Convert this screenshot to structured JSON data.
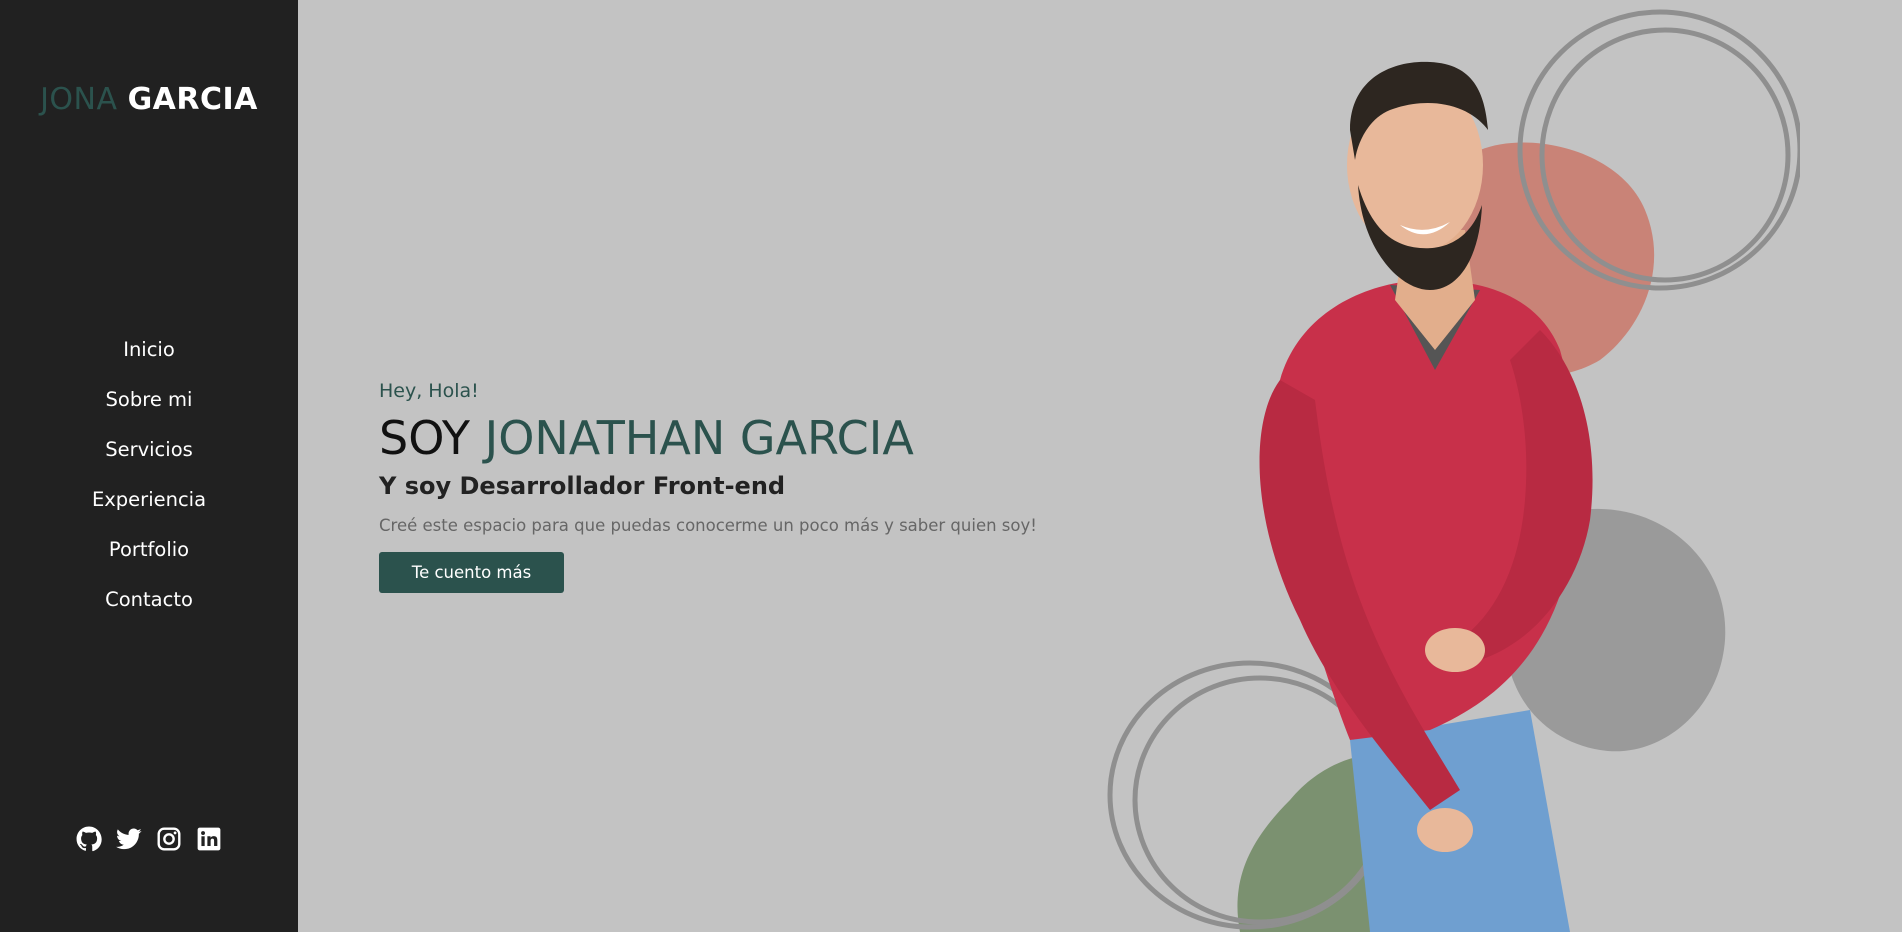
{
  "sidebar": {
    "logo_first": "JONA",
    "logo_last": "GARCIA",
    "nav": [
      "Inicio",
      "Sobre mi",
      "Servicios",
      "Experiencia",
      "Portfolio",
      "Contacto"
    ],
    "social_icons": [
      "github-icon",
      "twitter-icon",
      "instagram-icon",
      "linkedin-icon"
    ]
  },
  "hero": {
    "greeting": "Hey, Hola!",
    "headline_prefix": "SOY",
    "headline_name": "JONATHAN GARCIA",
    "subtitle": "Y soy Desarrollador Front-end",
    "description": "Creé este espacio para que puedas conocerme un poco más y saber quien soy!",
    "cta_label": "Te cuento más"
  },
  "colors": {
    "sidebar_bg": "#212121",
    "page_bg": "#c3c3c3",
    "accent": "#2b524d",
    "blob_red": "#c98377",
    "blob_green": "#7b9170",
    "blob_gray": "#9a9a9a",
    "sweater": "#c8304a"
  }
}
